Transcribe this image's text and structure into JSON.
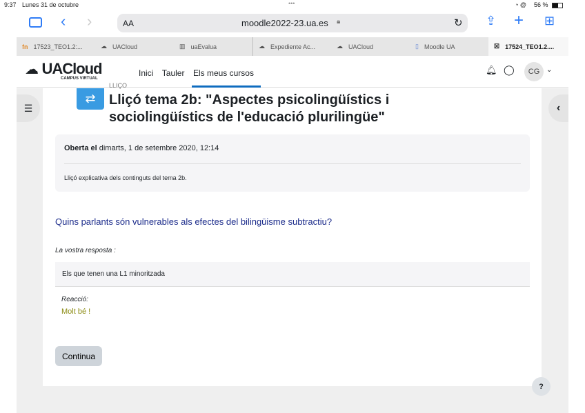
{
  "status": {
    "time": "9:37",
    "date": "Lunes 31 de octubre",
    "battery": "56 %"
  },
  "browser": {
    "text_size": "AA",
    "url": "moodle2022-23.ua.es"
  },
  "tabs": [
    {
      "label": "17523_TEO1.2:..."
    },
    {
      "label": "UACloud"
    },
    {
      "label": "uaEvalua"
    },
    {
      "label": "Expediente Ac..."
    },
    {
      "label": "UACloud"
    },
    {
      "label": "Moodle UA"
    },
    {
      "label": "17524_TEO1.2...."
    }
  ],
  "header": {
    "logo": "UACloud",
    "logo_sub": "CAMPUS VIRTUAL",
    "nav": [
      "Inici",
      "Tauler",
      "Els meus cursos"
    ],
    "avatar": "CG"
  },
  "page": {
    "kicker": "LLIÇÓ",
    "title": "Lliçó tema 2b: \"Aspectes psicolingüístics i sociolingüístics de l'educació plurilingüe\"",
    "opened_label": "Oberta el",
    "opened_date": "dimarts, 1 de setembre 2020, 12:14",
    "description": "Lliçó explicativa dels continguts del tema 2b.",
    "question": "Quins parlants són vulnerables als efectes del bilingüisme subtractiu?",
    "answer_label": "La vostra resposta :",
    "answer": "Els que tenen una L1 minoritzada",
    "feedback_label": "Reacció:",
    "feedback": "Molt bé !",
    "continue": "Continua",
    "help": "?"
  }
}
